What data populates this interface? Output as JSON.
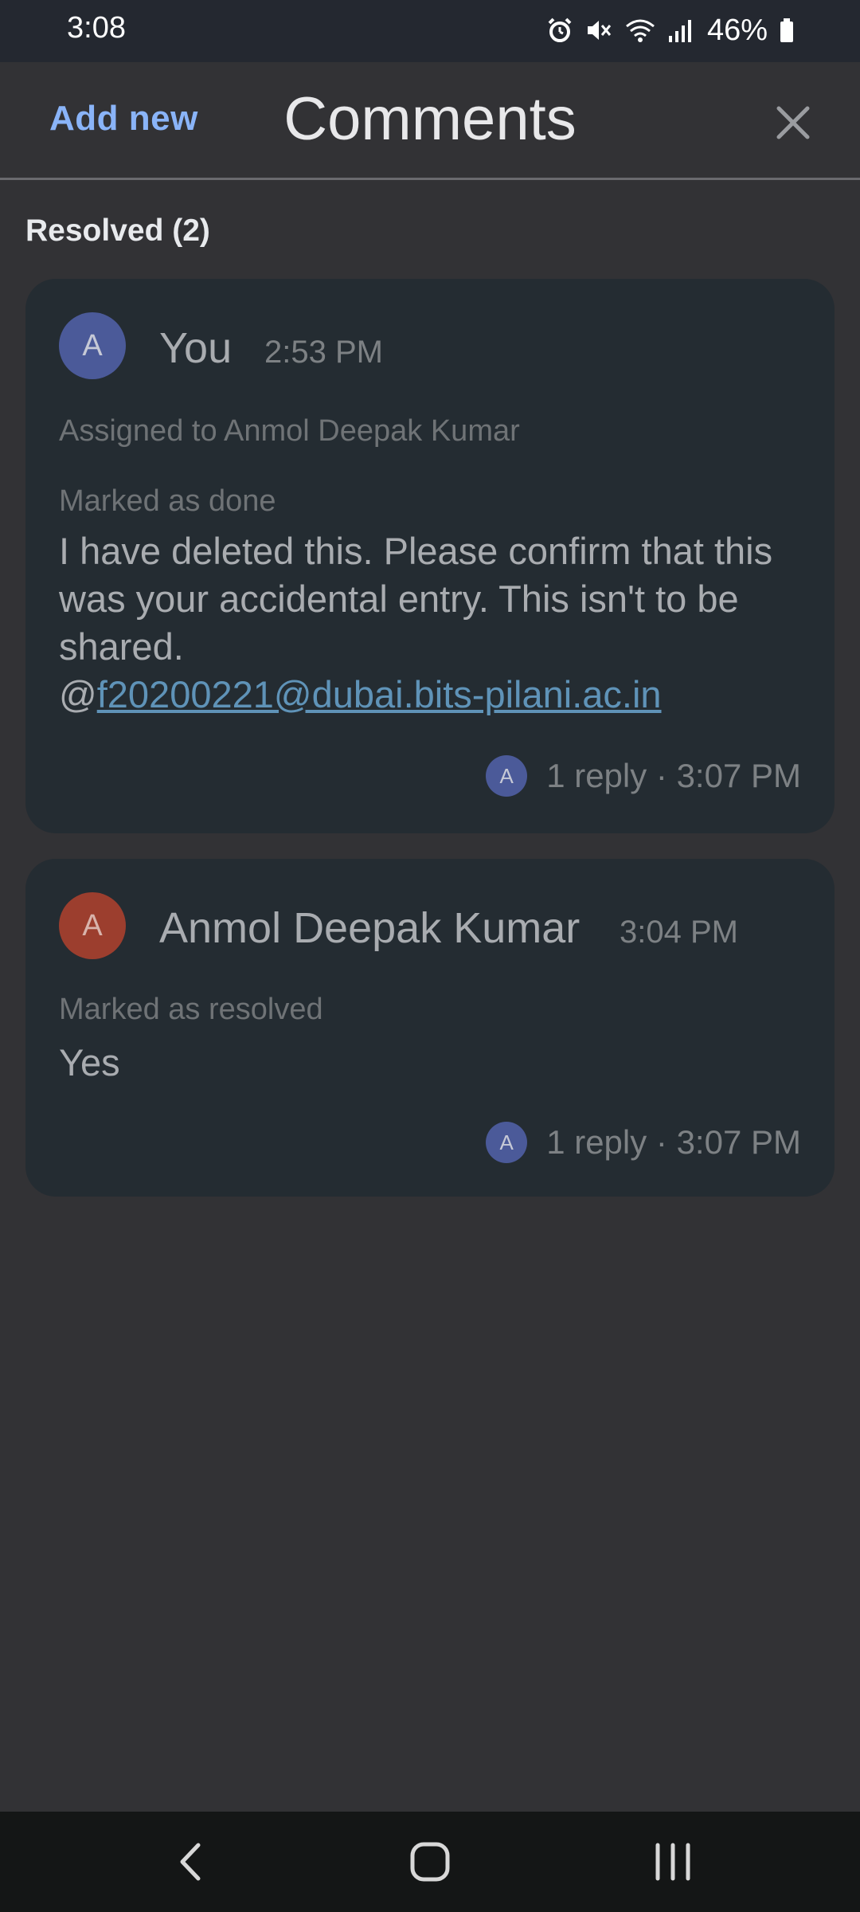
{
  "status_bar": {
    "time": "3:08",
    "battery": "46%",
    "icons": [
      "alarm-icon",
      "mute-icon",
      "wifi-icon",
      "signal-icon",
      "battery-icon"
    ]
  },
  "header": {
    "add_new_label": "Add new",
    "title": "Comments",
    "close_icon": "close-icon"
  },
  "section": {
    "label": "Resolved (2)"
  },
  "comments": [
    {
      "avatar_letter": "A",
      "author": "You",
      "time": "2:53 PM",
      "assigned": "Assigned to Anmol Deepak Kumar",
      "status": "Marked as done",
      "body": "I have deleted this. Please confirm that this was your accidental entry. This isn't to be shared.",
      "mention_prefix": "@",
      "mention": "f20200221@dubai.bits-pilani.ac.in",
      "reply_avatar": "A",
      "reply_info": "1 reply · 3:07 PM"
    },
    {
      "avatar_letter": "A",
      "author": "Anmol Deepak Kumar",
      "time": "3:04 PM",
      "status": "Marked as resolved",
      "body": "Yes",
      "reply_avatar": "A",
      "reply_info": "1 reply · 3:07 PM"
    }
  ],
  "colors": {
    "accent": "#8ab4f8",
    "background": "#323235",
    "card": "#242c32",
    "avatar_you": "#4b5a99",
    "avatar_other": "#9c3e2e",
    "link": "#5f93b8"
  },
  "nav_bar": {
    "icons": [
      "back-icon",
      "home-icon",
      "recents-icon"
    ]
  }
}
